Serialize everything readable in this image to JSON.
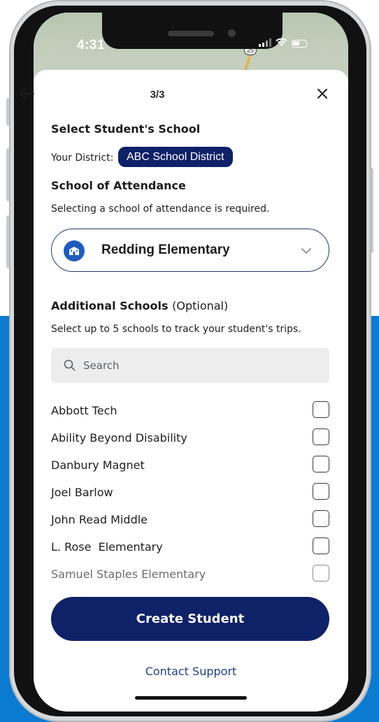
{
  "status_bar": {
    "time": "4:31",
    "route_shield": "25"
  },
  "header": {
    "step": "3/3"
  },
  "select_school": {
    "title": "Select Student's School",
    "district_label": "Your District:",
    "district_value": "ABC School District"
  },
  "attendance": {
    "title": "School of Attendance",
    "note": "Selecting a school of attendance is required.",
    "selected_school": "Redding Elementary"
  },
  "additional": {
    "title": "Additional Schools",
    "optional": "(Optional)",
    "note": "Select up to 5 schools to track your student's trips.",
    "search_placeholder": "Search",
    "schools": [
      {
        "label": "Abbott Tech",
        "checked": false
      },
      {
        "label": "Ability Beyond Disability",
        "checked": false
      },
      {
        "label": "Danbury Magnet",
        "checked": false
      },
      {
        "label": "Joel Barlow",
        "checked": false
      },
      {
        "label": "John Read Middle",
        "checked": false
      },
      {
        "label": "L. Rose  Elementary",
        "checked": false
      },
      {
        "label": "Samuel Staples Elementary",
        "checked": false
      }
    ]
  },
  "actions": {
    "create_label": "Create Student",
    "support_label": "Contact Support"
  },
  "colors": {
    "primary_navy": "#0f2167",
    "accent_blue": "#1e5cc0",
    "background_blue": "#0a7bd0",
    "link_blue": "#1e3f8a"
  }
}
